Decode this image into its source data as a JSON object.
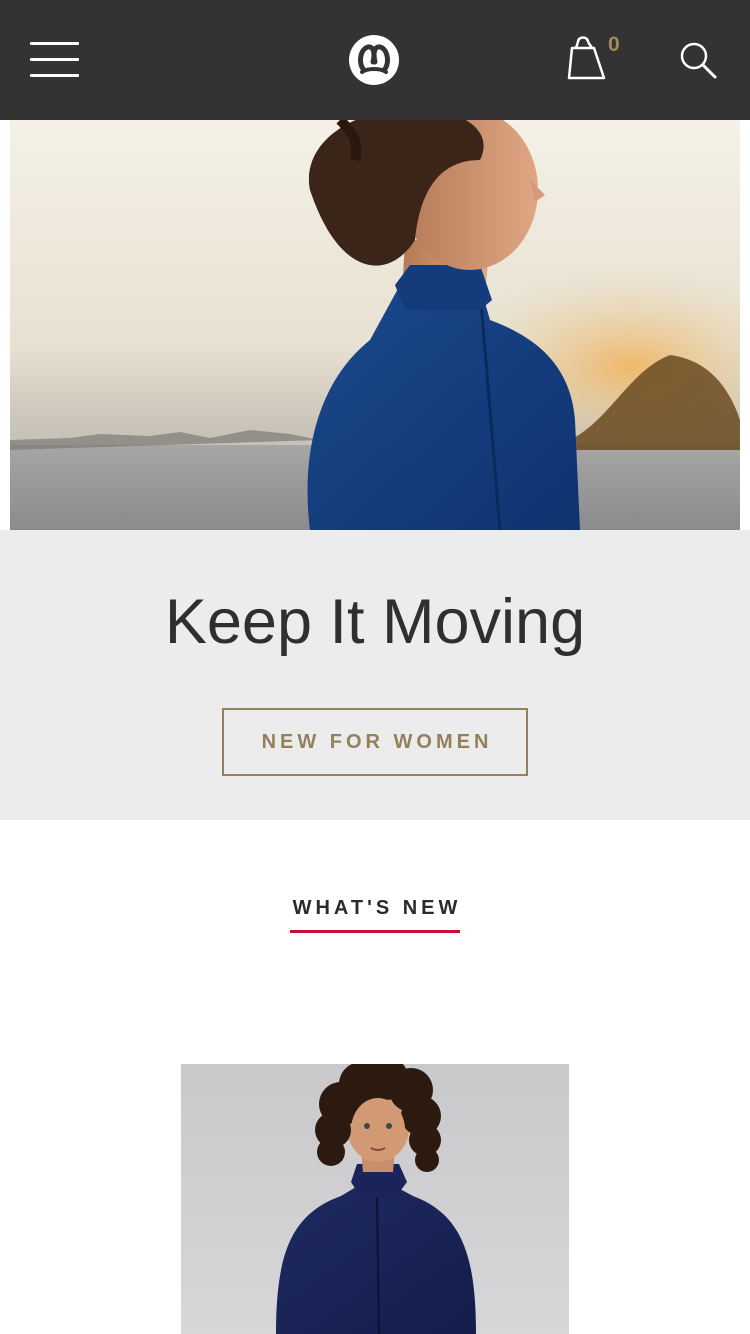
{
  "header": {
    "menu_icon": "hamburger-menu-icon",
    "logo_icon": "lululemon-logo-icon",
    "cart_icon": "shopping-bag-icon",
    "cart_count": "0",
    "search_icon": "search-icon",
    "background": "#333333",
    "accent": "#a08a55"
  },
  "hero": {
    "image": "woman-in-blue-zip-jacket-photo"
  },
  "promo": {
    "title": "Keep It Moving",
    "cta_label": "NEW FOR WOMEN",
    "background": "#ececec",
    "cta_color": "#94805a"
  },
  "whats_new": {
    "heading": "WHAT'S NEW",
    "underline_color": "#c8102e"
  },
  "product": {
    "image": "model-in-navy-jacket-photo"
  }
}
